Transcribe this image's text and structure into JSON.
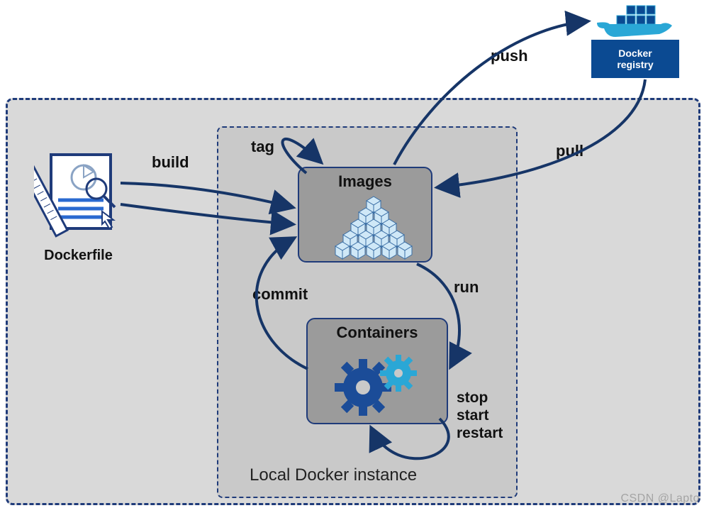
{
  "nodes": {
    "dockerfile": {
      "label": "Dockerfile"
    },
    "images": {
      "label": "Images"
    },
    "containers": {
      "label": "Containers"
    },
    "registry": {
      "line1": "Docker",
      "line2": "registry"
    }
  },
  "region": {
    "local_label": "Local Docker instance"
  },
  "edges": {
    "build": "build",
    "tag": "tag",
    "push": "push",
    "pull": "pull",
    "run": "run",
    "commit": "commit",
    "lifecycle": {
      "stop": "stop",
      "start": "start",
      "restart": "restart"
    }
  },
  "watermark": "CSDN @Lapto",
  "diagram": {
    "type": "flow",
    "description": "Docker component workflow: Dockerfile builds Images; Images can be tagged, pushed to and pulled from a Docker registry; Images run into Containers; Containers commit back to Images; Containers support stop/start/restart lifecycle.",
    "nodes": [
      "Dockerfile",
      "Images",
      "Containers",
      "Docker registry"
    ],
    "edges": [
      {
        "from": "Dockerfile",
        "to": "Images",
        "label": "build"
      },
      {
        "from": "Images",
        "to": "Images",
        "label": "tag"
      },
      {
        "from": "Images",
        "to": "Docker registry",
        "label": "push"
      },
      {
        "from": "Docker registry",
        "to": "Images",
        "label": "pull"
      },
      {
        "from": "Images",
        "to": "Containers",
        "label": "run"
      },
      {
        "from": "Containers",
        "to": "Images",
        "label": "commit"
      },
      {
        "from": "Containers",
        "to": "Containers",
        "label": "stop"
      },
      {
        "from": "Containers",
        "to": "Containers",
        "label": "start"
      },
      {
        "from": "Containers",
        "to": "Containers",
        "label": "restart"
      }
    ],
    "regions": [
      {
        "name": "Local Docker instance",
        "contains": [
          "Images",
          "Containers"
        ]
      }
    ]
  }
}
